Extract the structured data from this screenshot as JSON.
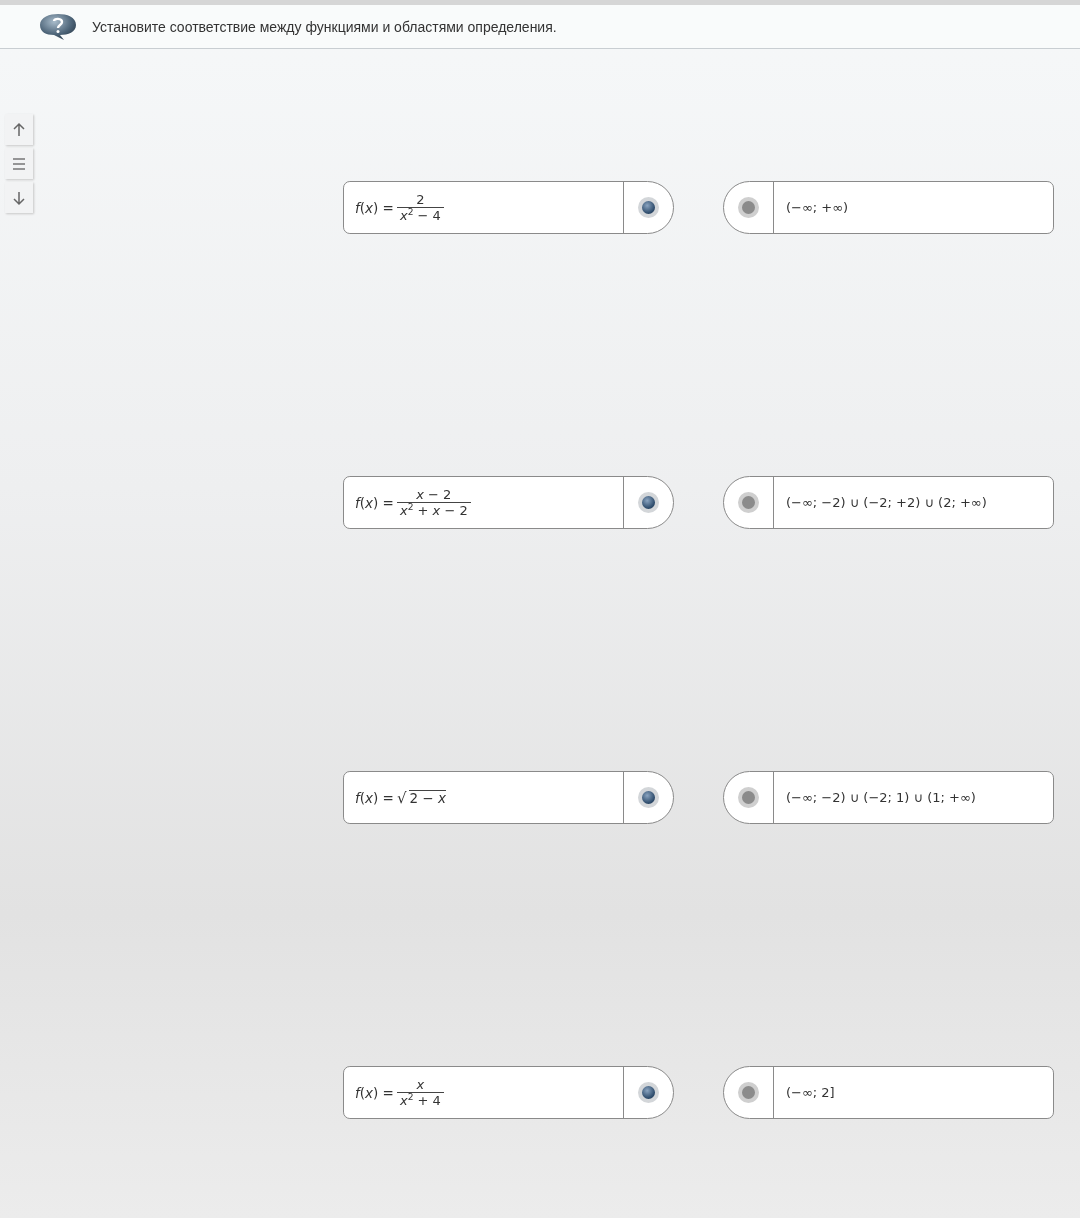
{
  "header": {
    "title": "Установите соответствие между функциями и областями определения."
  },
  "nav_buttons": [
    {
      "kind": "up"
    },
    {
      "kind": "list"
    },
    {
      "kind": "down"
    }
  ],
  "functions": [
    {
      "kind": "fraction",
      "lhs": "*f*(*x*) =",
      "numerator": "2",
      "denominator": "*x*$^{2}$ − 4"
    },
    {
      "kind": "fraction",
      "lhs": "*f*(*x*) =",
      "numerator": "*x* − 2",
      "denominator": "*x*$^{2}$ + *x* − 2"
    },
    {
      "kind": "sqrt",
      "lhs": "*f*(*x*) =",
      "radical": "√",
      "radicand": "2 − *x*"
    },
    {
      "kind": "fraction",
      "lhs": "*f*(*x*) =",
      "numerator": "*x*",
      "denominator": "*x*$^{2}$ + 4"
    }
  ],
  "domains": [
    {
      "text": "(−∞; +∞)"
    },
    {
      "text": "(−∞; −2) ∪ (−2; +2) ∪ (2; +∞)"
    },
    {
      "text": "(−∞; −2) ∪ (−2; 1) ∪ (1; +∞)"
    },
    {
      "text": "(−∞; 2]"
    }
  ]
}
